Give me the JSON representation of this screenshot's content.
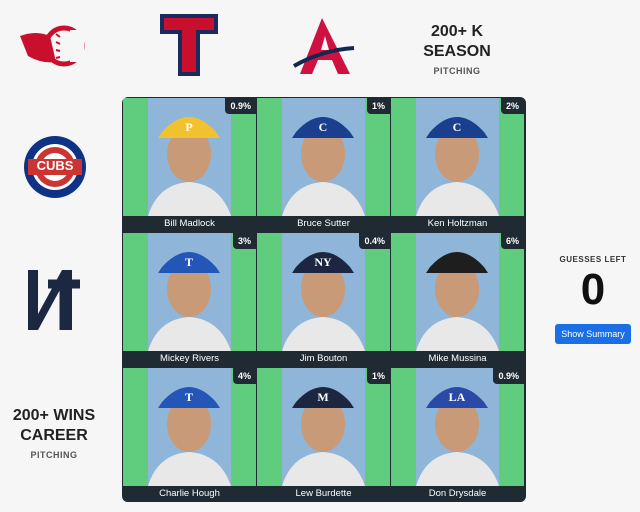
{
  "columns": [
    {
      "team": "Cincinnati Reds",
      "icon": "reds-logo-icon"
    },
    {
      "team": "Texas Rangers",
      "icon": "rangers-logo-icon"
    },
    {
      "team": "Atlanta Braves",
      "icon": "braves-logo-icon"
    },
    {
      "main_line1": "200+ K",
      "main_line2": "SEASON",
      "sub": "PITCHING"
    }
  ],
  "rows": [
    {
      "team": "Chicago Cubs",
      "icon": "cubs-logo-icon",
      "logo_text": "CUBS"
    },
    {
      "team": "New York Yankees",
      "icon": "yankees-logo-icon"
    },
    {
      "main_line1": "200+ WINS",
      "main_line2": "CAREER",
      "sub": "PITCHING"
    }
  ],
  "cells": [
    {
      "name": "Bill Madlock",
      "pct": "0.9%",
      "cap_color": "#f2c12e",
      "cap_letter": "P"
    },
    {
      "name": "Bruce Sutter",
      "pct": "1%",
      "cap_color": "#1b3f8f",
      "cap_letter": "C"
    },
    {
      "name": "Ken Holtzman",
      "pct": "2%",
      "cap_color": "#1b3f8f",
      "cap_letter": "C"
    },
    {
      "name": "Mickey Rivers",
      "pct": "3%",
      "cap_color": "#2456b8",
      "cap_letter": "T"
    },
    {
      "name": "Jim Bouton",
      "pct": "0.4%",
      "cap_color": "#1c2640",
      "cap_letter": "NY"
    },
    {
      "name": "Mike Mussina",
      "pct": "6%",
      "cap_color": "#1e1e1e",
      "cap_letter": ""
    },
    {
      "name": "Charlie Hough",
      "pct": "4%",
      "cap_color": "#2456b8",
      "cap_letter": "T"
    },
    {
      "name": "Lew Burdette",
      "pct": "1%",
      "cap_color": "#1c2640",
      "cap_letter": "M"
    },
    {
      "name": "Don Drysdale",
      "pct": "0.9%",
      "cap_color": "#2b4aa8",
      "cap_letter": "LA"
    }
  ],
  "guesses": {
    "label": "GUESSES LEFT",
    "count": "0"
  },
  "summary_button": "Show Summary",
  "colors": {
    "cell_bg": "#5fcc7e",
    "grid_border": "#1f2a33",
    "button": "#1a6fe6"
  }
}
